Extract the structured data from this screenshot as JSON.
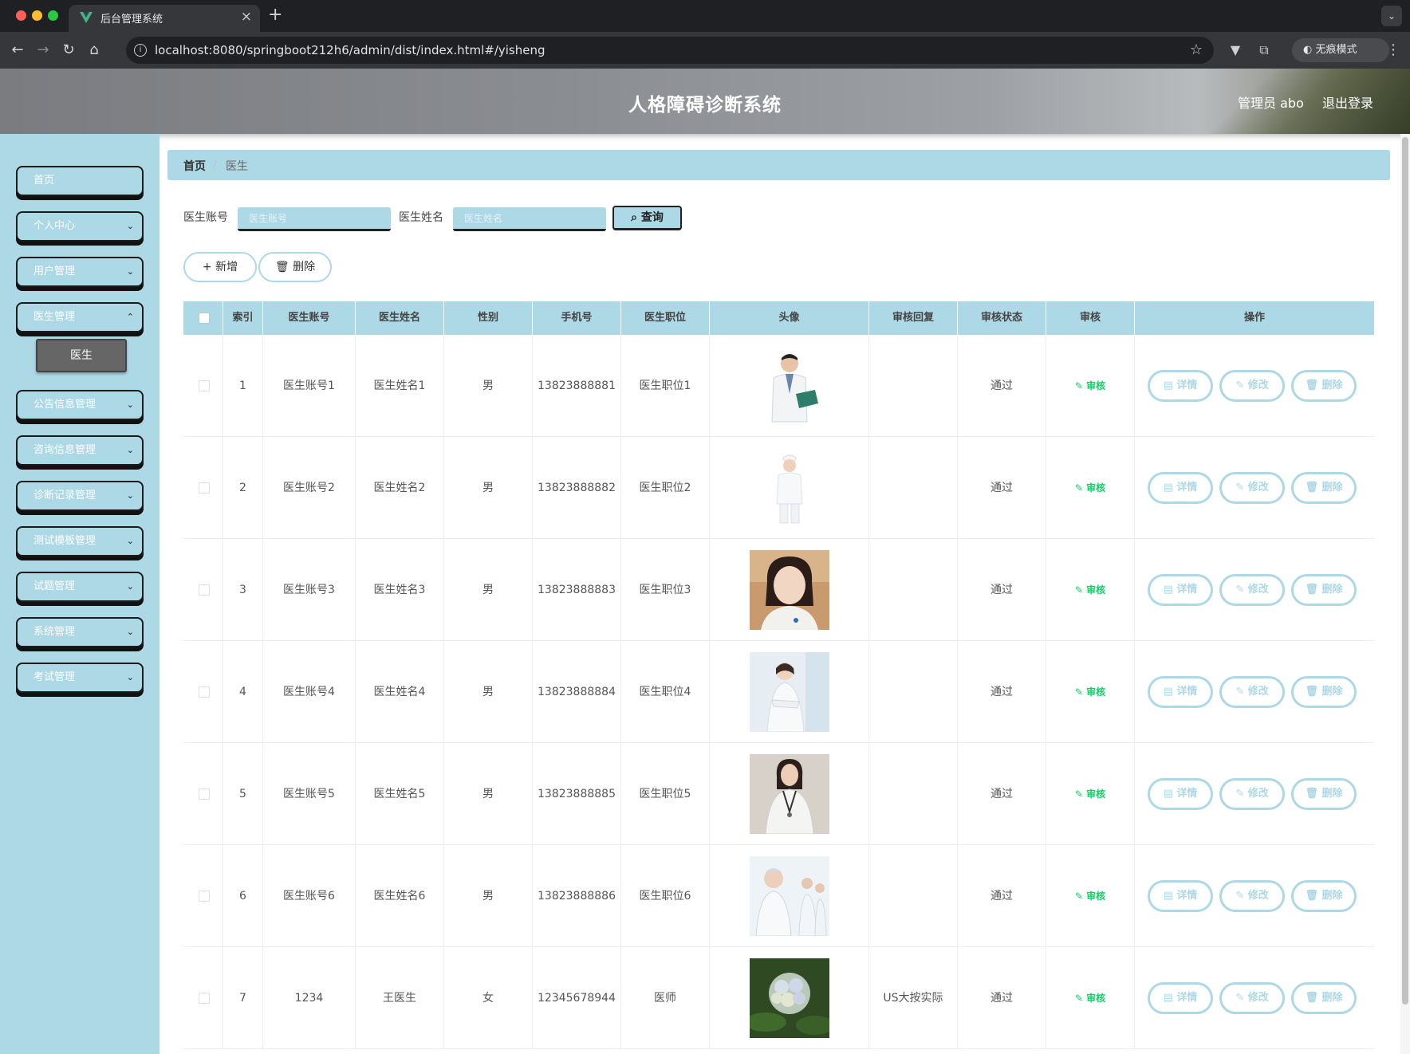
{
  "browser": {
    "tab_title": "后台管理系统",
    "tab_close": "×",
    "new_tab": "+",
    "url": "localhost:8080/springboot212h6/admin/dist/index.html#/yisheng",
    "incognito_label": "无痕模式"
  },
  "header": {
    "title": "人格障碍诊断系统",
    "admin_label": "管理员 abo",
    "logout_label": "退出登录"
  },
  "sidebar": {
    "items": [
      {
        "label": "首页",
        "expandable": false
      },
      {
        "label": "个人中心",
        "expandable": true
      },
      {
        "label": "用户管理",
        "expandable": true
      },
      {
        "label": "医生管理",
        "expandable": true
      },
      {
        "label": "公告信息管理",
        "expandable": true
      },
      {
        "label": "咨询信息管理",
        "expandable": true
      },
      {
        "label": "诊断记录管理",
        "expandable": true
      },
      {
        "label": "测试模板管理",
        "expandable": true
      },
      {
        "label": "试题管理",
        "expandable": true
      },
      {
        "label": "系统管理",
        "expandable": true
      },
      {
        "label": "考试管理",
        "expandable": true
      }
    ],
    "active_subitem": "医生"
  },
  "breadcrumb": {
    "home": "首页",
    "separator": "/",
    "current": "医生"
  },
  "filters": {
    "account_label": "医生账号",
    "account_placeholder": "医生账号",
    "name_label": "医生姓名",
    "name_placeholder": "医生姓名",
    "search_label": "查询"
  },
  "actions": {
    "add_label": "新增",
    "delete_label": "删除"
  },
  "table": {
    "columns": [
      "索引",
      "医生账号",
      "医生姓名",
      "性别",
      "手机号",
      "医生职位",
      "头像",
      "审核回复",
      "审核状态",
      "审核",
      "操作"
    ],
    "audit_link_label": "审核",
    "op_labels": {
      "detail": "详情",
      "edit": "修改",
      "delete": "删除"
    },
    "rows": [
      {
        "index": "1",
        "account": "医生账号1",
        "name": "医生姓名1",
        "gender": "男",
        "phone": "13823888881",
        "position": "医生职位1",
        "reply": "",
        "status": "通过",
        "avatar": "doctor-male-clipboard"
      },
      {
        "index": "2",
        "account": "医生账号2",
        "name": "医生姓名2",
        "gender": "男",
        "phone": "13823888882",
        "position": "医生职位2",
        "reply": "",
        "status": "通过",
        "avatar": "nurse-white-uniform"
      },
      {
        "index": "3",
        "account": "医生账号3",
        "name": "医生姓名3",
        "gender": "男",
        "phone": "13823888883",
        "position": "医生职位3",
        "reply": "",
        "status": "通过",
        "avatar": "doctor-female-portrait"
      },
      {
        "index": "4",
        "account": "医生账号4",
        "name": "医生姓名4",
        "gender": "男",
        "phone": "13823888884",
        "position": "医生职位4",
        "reply": "",
        "status": "通过",
        "avatar": "doctor-female-arms-crossed"
      },
      {
        "index": "5",
        "account": "医生账号5",
        "name": "医生姓名5",
        "gender": "男",
        "phone": "13823888885",
        "position": "医生职位5",
        "reply": "",
        "status": "通过",
        "avatar": "doctor-female-stethoscope"
      },
      {
        "index": "6",
        "account": "医生账号6",
        "name": "医生姓名6",
        "gender": "男",
        "phone": "13823888886",
        "position": "医生职位6",
        "reply": "",
        "status": "通过",
        "avatar": "doctors-group"
      },
      {
        "index": "7",
        "account": "1234",
        "name": "王医生",
        "gender": "女",
        "phone": "12345678944",
        "position": "医师",
        "reply": "US大按实际",
        "status": "通过",
        "avatar": "hydrangea-flower"
      }
    ]
  },
  "colors": {
    "accent": "#add8e6",
    "audit_green": "#13ce66",
    "active_submenu": "#666666"
  }
}
